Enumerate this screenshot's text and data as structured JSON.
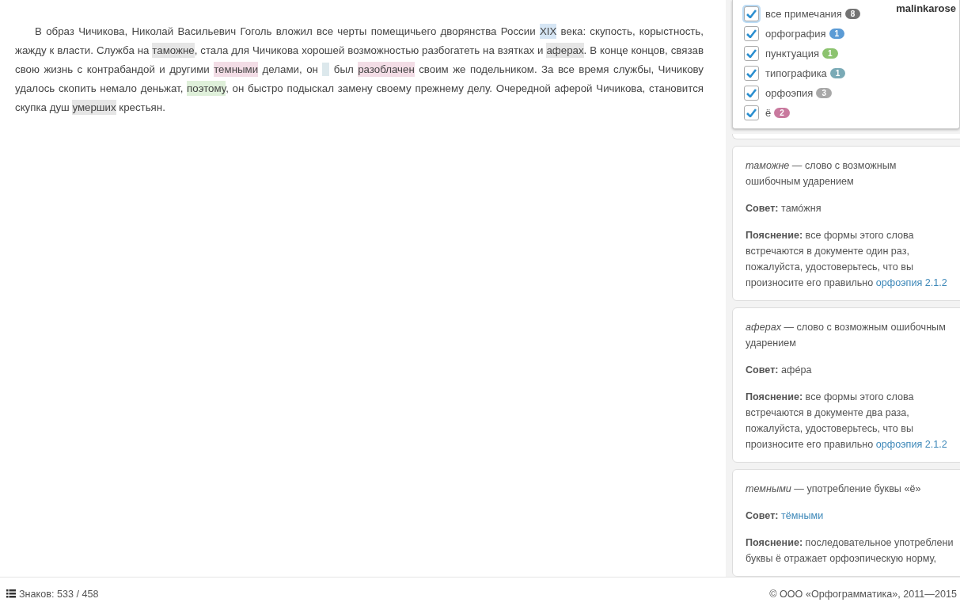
{
  "document": {
    "segments": [
      {
        "text": "В образ Чичикова, Николай Васильевич Гоголь вложил все черты помещичьего дворянства России "
      },
      {
        "text": "XIX",
        "color": "#d6e6f5"
      },
      {
        "text": " века: скупость, корыстность, жажду к власти. Служба на "
      },
      {
        "text": "таможне",
        "color": "#e6e6e6"
      },
      {
        "text": ", стала для Чичикова хорошей возможностью разбогатеть на взятках и "
      },
      {
        "text": "аферах",
        "color": "#e6e6e6"
      },
      {
        "text": ". В конце концов, связав свою жизнь с контрабандой и другими "
      },
      {
        "text": "темными",
        "color": "#f3dde6"
      },
      {
        "text": " делами, он "
      },
      {
        "kind": "gap",
        "color": "#dce8ec"
      },
      {
        "text": " был "
      },
      {
        "text": "разоблачен",
        "color": "#f3dde6"
      },
      {
        "text": " своим же подельником. За все время службы, Чичикову удалось скопить немало деньжат, "
      },
      {
        "text": "поэтому",
        "color": "#dff0da"
      },
      {
        "text": ", он быстро подыскал замену своему прежнему делу. Очередной аферой Чичикова, становится скупка душ "
      },
      {
        "text": "умерших",
        "color": "#e6e6e6"
      },
      {
        "text": " крестьян."
      }
    ]
  },
  "user": "malinkarose",
  "filters": [
    {
      "label": "все примечания",
      "count": "8",
      "checked": true,
      "focused": true,
      "color": "#737373"
    },
    {
      "label": "орфография",
      "count": "1",
      "checked": true,
      "focused": false,
      "color": "#5b9bd5"
    },
    {
      "label": "пунктуация",
      "count": "1",
      "checked": true,
      "focused": false,
      "color": "#8cc36f"
    },
    {
      "label": "типографика",
      "count": "1",
      "checked": true,
      "focused": false,
      "color": "#7aaab6"
    },
    {
      "label": "орфоэпия",
      "count": "3",
      "checked": true,
      "focused": false,
      "color": "#a8a8a8"
    },
    {
      "label": "ё",
      "count": "2",
      "checked": true,
      "focused": false,
      "color": "#c9799e"
    }
  ],
  "notes": [
    {
      "word": "таможне",
      "title_lines": [
        "— слово с возможным",
        "ошибочным ударением"
      ],
      "advice_label": "Совет:",
      "advice": "тамóжня",
      "advice_link": false,
      "explanation_label": "Пояснение:",
      "explanation_lines": [
        "все формы этого слова",
        "встречаются в документе один раз,",
        "пожалуйста, удостоверьтесь, что вы",
        "произносите его правильно"
      ],
      "link": "орфоэпия 2.1.2"
    },
    {
      "word": "аферах",
      "title_lines": [
        "— слово с возможным ошибочным",
        "ударением"
      ],
      "advice_label": "Совет:",
      "advice": "афéра",
      "advice_link": false,
      "explanation_label": "Пояснение:",
      "explanation_lines": [
        "все формы этого слова",
        "встречаются в документе два раза,",
        "пожалуйста, удостоверьтесь, что вы",
        "произносите его правильно"
      ],
      "link": "орфоэпия 2.1.2"
    },
    {
      "word": "темными",
      "title_lines": [
        "— употребление буквы «ё»"
      ],
      "advice_label": "Совет:",
      "advice": "тёмными",
      "advice_link": true,
      "explanation_label": "Пояснение:",
      "explanation_lines": [
        "последовательное употреблени",
        "буквы ё отражает орфоэпическую норму,"
      ]
    }
  ],
  "status_bar": {
    "counter": "Знаков: 533 / 458",
    "copyright": "© ООО «Орфограмматика», 2011—2015"
  }
}
